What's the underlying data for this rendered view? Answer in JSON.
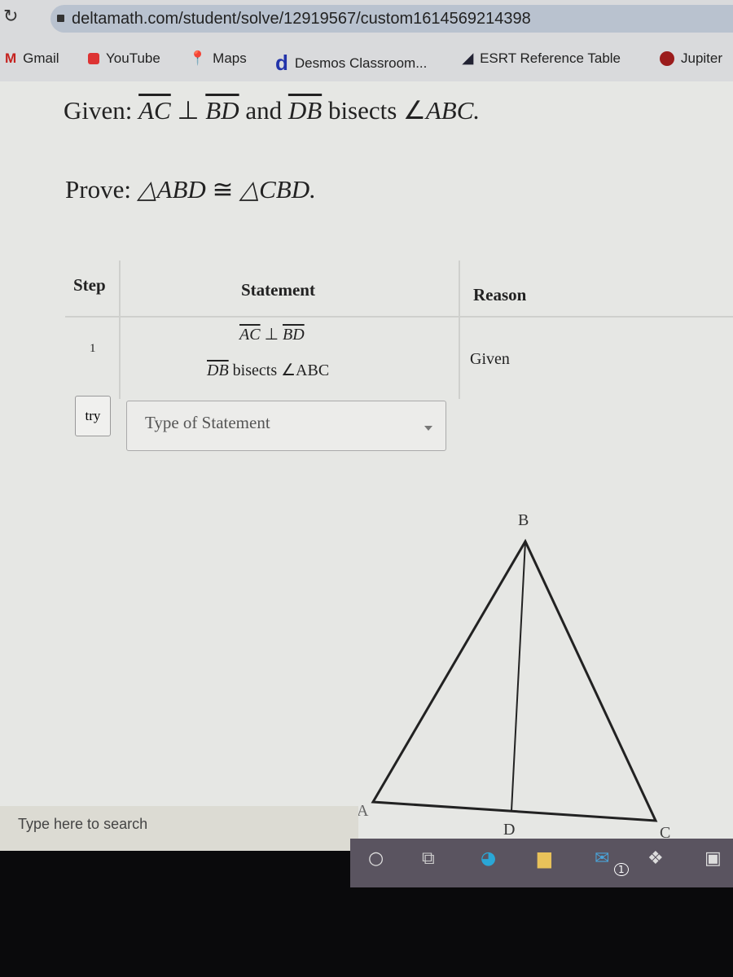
{
  "browser": {
    "url": "deltamath.com/student/solve/12919567/custom1614569214398",
    "bookmarks": [
      {
        "label": "Gmail",
        "icon": "gmail-icon"
      },
      {
        "label": "YouTube",
        "icon": "youtube-icon"
      },
      {
        "label": "Maps",
        "icon": "maps-icon"
      },
      {
        "label": "Desmos Classroom...",
        "icon": "desmos-icon"
      },
      {
        "label": "ESRT Reference Table",
        "icon": "ny-state-icon"
      },
      {
        "label": "Jupiter",
        "icon": "jupiter-icon"
      }
    ]
  },
  "problem": {
    "given_prefix": "Given:",
    "seg1": "AC",
    "perp": "⊥",
    "seg2": "BD",
    "and": "and",
    "seg3": "DB",
    "bisects": "bisects ∠",
    "angle": "ABC.",
    "prove_prefix": "Prove:",
    "prove_tri1": "△ABD",
    "congruent": "≅",
    "prove_tri2": "△CBD."
  },
  "table": {
    "headers": {
      "step": "Step",
      "statement": "Statement",
      "reason": "Reason"
    },
    "rows": [
      {
        "step": "1",
        "statement_line1_a": "AC",
        "statement_line1_b": "⊥",
        "statement_line1_c": "BD",
        "statement_line2_a": "DB",
        "statement_line2_b": "bisects ∠ABC",
        "reason": "Given"
      }
    ],
    "try_label": "try",
    "dropdown_placeholder": "Type of Statement"
  },
  "diagram": {
    "points": {
      "A": "A",
      "B": "B",
      "C": "C",
      "D": "D"
    }
  },
  "taskbar": {
    "search_placeholder": "Type here to search",
    "mail_badge": "1"
  }
}
